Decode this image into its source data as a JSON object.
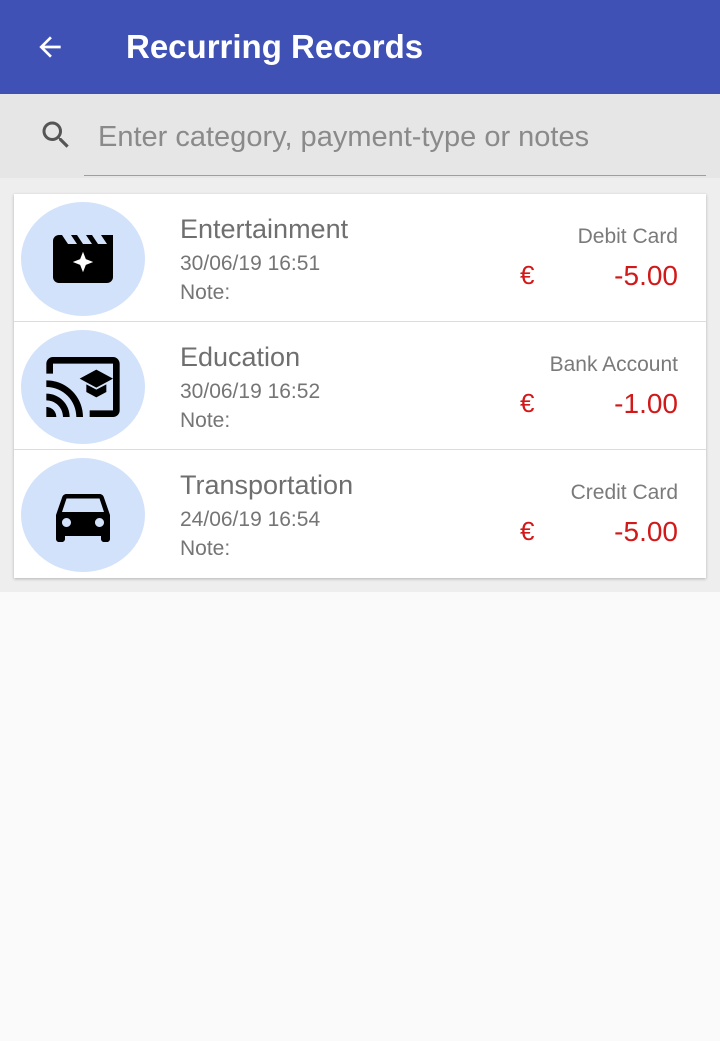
{
  "appbar": {
    "title": "Recurring Records",
    "back_icon": "arrow-back-icon",
    "color": "#3f51b5"
  },
  "search": {
    "placeholder": "Enter category, payment-type or notes",
    "icon": "search-icon"
  },
  "records": [
    {
      "category": "Entertainment",
      "icon": "movie-icon",
      "date": "30/06/19 16:51",
      "note_label": "Note:",
      "payment_type": "Debit Card",
      "currency": "€",
      "amount": "-5.00"
    },
    {
      "category": "Education",
      "icon": "cast-for-education-icon",
      "date": "30/06/19 16:52",
      "note_label": "Note:",
      "payment_type": "Bank Account",
      "currency": "€",
      "amount": "-1.00"
    },
    {
      "category": "Transportation",
      "icon": "car-icon",
      "date": "24/06/19 16:54",
      "note_label": "Note:",
      "payment_type": "Credit Card",
      "currency": "€",
      "amount": "-5.00"
    }
  ],
  "colors": {
    "amount": "#d21919",
    "avatar_bg": "#d3e2fb"
  }
}
